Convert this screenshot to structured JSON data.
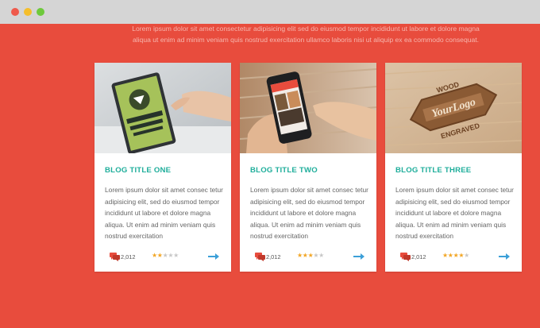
{
  "window": {
    "controls": [
      "close",
      "minimize",
      "maximize"
    ]
  },
  "intro": {
    "line1": "Lorem ipsum dolor sit amet consectetur adipisicing elit sed do eiusmod tempor incididunt ut labore et dolore magna",
    "line2": "aliqua ut enim ad minim veniam quis nostrud exercitation ullamco laboris nisi ut aliquip ex ea commodo consequat."
  },
  "colors": {
    "background": "#e84c3d",
    "accent": "#1fae9b",
    "star": "#f2a625",
    "arrow": "#3b9fd8"
  },
  "cards": [
    {
      "title": "BLOG TITLE ONE",
      "excerpt": "Lorem ipsum dolor sit amet consec tetur adipisicing elit, sed do eiusmod tempor incididunt ut labore et dolore magna aliqua. Ut enim ad minim veniam quis nostrud exercitation",
      "comments": "2,012",
      "rating": 2,
      "rating_max": 5,
      "image_icon": "tablet-photo-icon"
    },
    {
      "title": "BLOG TITLE TWO",
      "excerpt": "Lorem ipsum dolor sit amet consec tetur adipisicing elit, sed do eiusmod tempor incididunt ut labore et dolore magna aliqua. Ut enim ad minim veniam quis nostrud exercitation",
      "comments": "2,012",
      "rating": 3,
      "rating_max": 5,
      "image_icon": "phone-photo-icon"
    },
    {
      "title": "BLOG TITLE THREE",
      "excerpt": "Lorem ipsum dolor sit amet consec tetur adipisicing elit, sed do eiusmod tempor incididunt ut labore et dolore magna aliqua. Ut enim ad minim veniam quis nostrud exercitation",
      "comments": "2,012",
      "rating": 4,
      "rating_max": 5,
      "image_icon": "wood-logo-photo-icon"
    }
  ],
  "logo_photo_text": {
    "top": "WOOD",
    "middle": "YourLogo",
    "bottom": "ENGRAVED"
  }
}
